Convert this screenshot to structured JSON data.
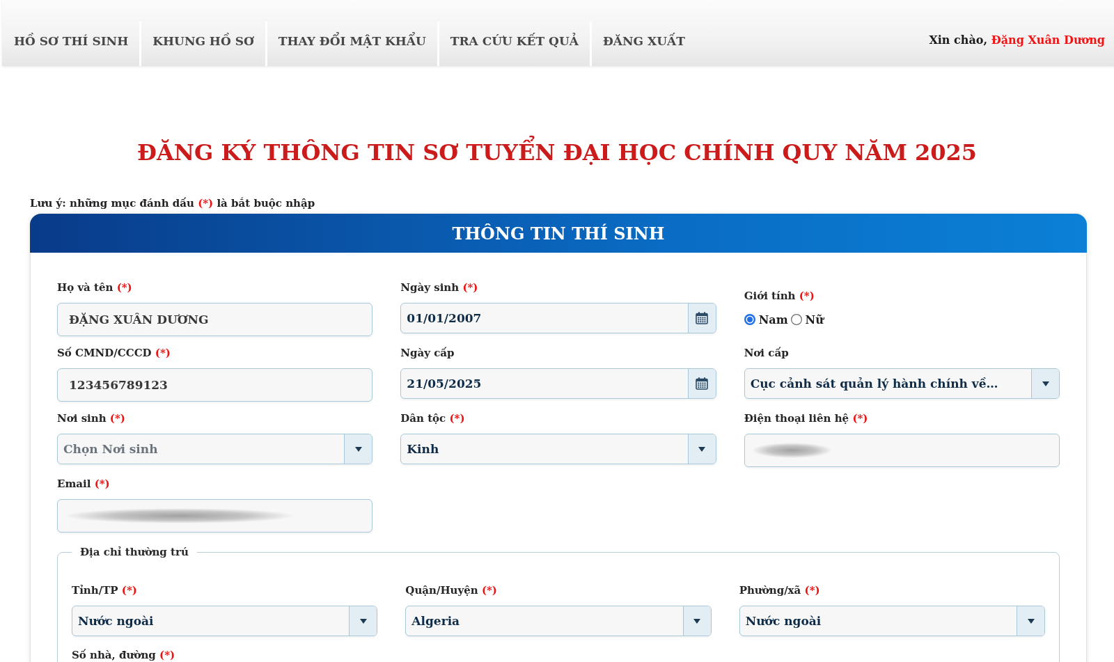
{
  "nav": {
    "items": [
      {
        "label": "HỒ SƠ THÍ SINH"
      },
      {
        "label": "KHUNG HỒ SƠ"
      },
      {
        "label": "THAY ĐỔI MẬT KHẨU"
      },
      {
        "label": "TRA CỨU KẾT QUẢ"
      },
      {
        "label": "ĐĂNG XUẤT"
      }
    ],
    "greeting": "Xin chào,",
    "user_name": "Đặng Xuân Dương"
  },
  "page_title": "ĐĂNG KÝ THÔNG TIN SƠ TUYỂN ĐẠI HỌC CHÍNH QUY NĂM 2025",
  "note": {
    "text_before": "Lưu ý: những mục đánh dấu",
    "mark": "(*)",
    "text_after": "là bắt buộc nhập"
  },
  "section": {
    "title": "THÔNG TIN THÍ SINH",
    "fields": [
      {
        "kind": "text",
        "label": "Họ và tên",
        "required_mark": "(*)",
        "value": "ĐẶNG XUÂN DƯƠNG"
      },
      {
        "kind": "date",
        "label": "Ngày sinh",
        "required_mark": "(*)",
        "value": "01/01/2007"
      },
      {
        "kind": "radio",
        "label": "Giới tính",
        "required_mark": "(*)",
        "options": [
          {
            "label": "Nam",
            "selected": true
          },
          {
            "label": "Nữ",
            "selected": false
          }
        ]
      },
      {
        "kind": "text",
        "label": "Số CMND/CCCD",
        "required_mark": "(*)",
        "value": "123456789123"
      },
      {
        "kind": "date",
        "label": "Ngày cấp",
        "value": "21/05/2025"
      },
      {
        "kind": "select",
        "label": "Nơi cấp",
        "value": "Cục cảnh sát quản lý hành chính về…"
      },
      {
        "kind": "select",
        "label": "Nơi sinh",
        "required_mark": "(*)",
        "placeholder": "Chọn Nơi sinh"
      },
      {
        "kind": "select",
        "label": "Dân tộc",
        "required_mark": "(*)",
        "value": "Kinh"
      },
      {
        "kind": "blurred",
        "label": "Điện thoại liên hệ",
        "required_mark": "(*)"
      },
      {
        "kind": "blurred",
        "label": "Email",
        "required_mark": "(*)"
      }
    ],
    "address": {
      "legend": "Địa chỉ thường trú",
      "fields": [
        {
          "kind": "select",
          "label": "Tỉnh/TP",
          "required_mark": "(*)",
          "value": "Nước ngoài"
        },
        {
          "kind": "select",
          "label": "Quận/Huyện",
          "required_mark": "(*)",
          "value": "Algeria"
        },
        {
          "kind": "select",
          "label": "Phường/xã",
          "required_mark": "(*)",
          "value": "Nước ngoài"
        },
        {
          "kind": "label",
          "label": "Số nhà, đường",
          "required_mark": "(*)"
        }
      ]
    }
  }
}
